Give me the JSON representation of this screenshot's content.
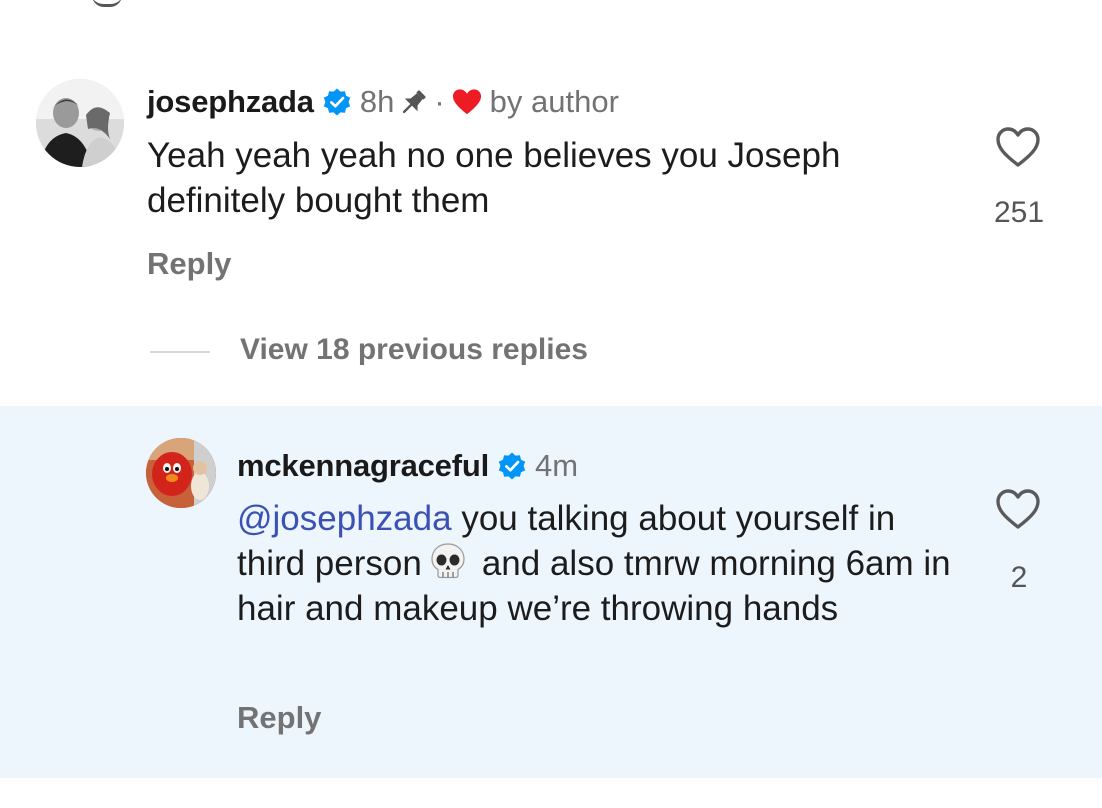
{
  "comments": [
    {
      "username": "josephzada",
      "verified": true,
      "time": "8h",
      "pinned": true,
      "liked_by_author_label": "by author",
      "text": "Yeah yeah yeah no one believes you Joseph definitely bought them",
      "reply_label": "Reply",
      "like_count": "251"
    },
    {
      "username": "mckennagraceful",
      "verified": true,
      "time": "4m",
      "mention": "@josephzada",
      "text_part1": "you talking about yourself in third person",
      "emoji": "skull",
      "text_part2": "and also tmrw morning 6am in hair and makeup we’re throwing hands",
      "reply_label": "Reply",
      "like_count": "2"
    }
  ],
  "view_replies_label": "View 18 previous replies",
  "colors": {
    "verified_blue": "#0095f6",
    "author_heart_red": "#ed1c24",
    "mention_blue": "#3b52b4",
    "highlight_background": "#eef6fd",
    "secondary_text": "#737373"
  }
}
